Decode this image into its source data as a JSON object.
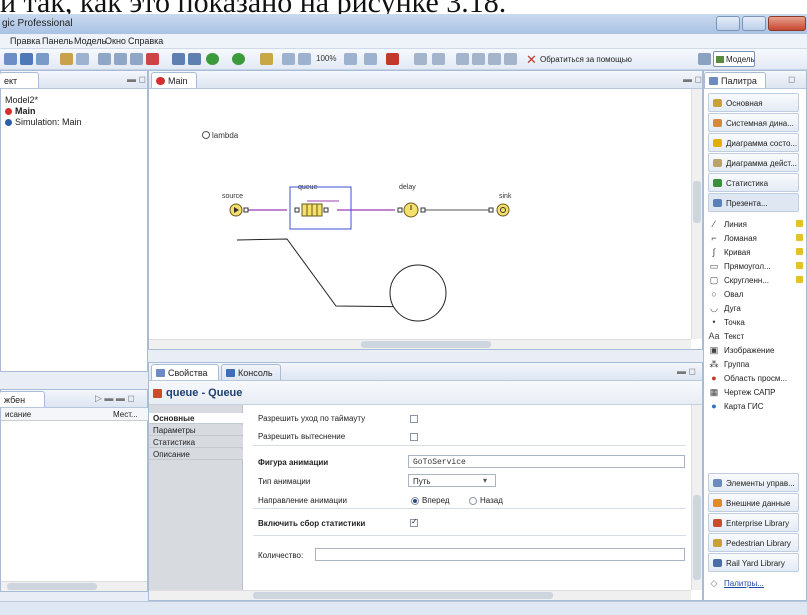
{
  "doc_heading": "и так, как это показано на рисунке 3.18.",
  "window": {
    "title": "gic Professional"
  },
  "menu": [
    "Правка",
    "Панель",
    "Модель",
    "Окно",
    "Справка"
  ],
  "toolbar": {
    "zoom": "100%",
    "help_link": "Обратиться за помощью",
    "model_button": "Модель"
  },
  "project": {
    "tab": "ект",
    "items": [
      "Model2*",
      "Main",
      "Simulation: Main"
    ]
  },
  "editor": {
    "tab": "Main",
    "lambda_label": "lambda",
    "blocks": {
      "source": "source",
      "queue": "queue",
      "delay": "delay",
      "sink": "sink"
    }
  },
  "palette": {
    "tab": "Палитра",
    "categories": [
      "Основная",
      "Системная дина...",
      "Диаграмма состо...",
      "Диаграмма дейст...",
      "Статистика",
      "Презента..."
    ],
    "items": [
      "Линия",
      "Ломаная",
      "Кривая",
      "Прямоугол...",
      "Скругленн...",
      "Овал",
      "Дуга",
      "Точка",
      "Текст",
      "Изображение",
      "Группа",
      "Область просм...",
      "Чертеж САПР",
      "Карта ГИС"
    ],
    "libraries": [
      "Элементы управ...",
      "Внешние данные",
      "Enterprise Library",
      "Pedestrian Library",
      "Rail Yard Library",
      "Палитры..."
    ]
  },
  "bottom_left": {
    "tab": "жбен",
    "columns": [
      "исание",
      "Мест..."
    ]
  },
  "properties": {
    "tab": "Свойства",
    "console_tab": "Консоль",
    "heading": "queue - Queue",
    "side_tabs": [
      "Основные",
      "Параметры",
      "Статистика",
      "Описание"
    ],
    "timeout_label": "Разрешить уход по таймауту",
    "preempt_label": "Разрешить вытеснение",
    "anim_shape_label": "Фигура анимации",
    "anim_shape_value": "GoToService",
    "anim_type_label": "Тип анимации",
    "anim_type_value": "Путь",
    "anim_dir_label": "Направление анимации",
    "anim_dir_forward": "Вперед",
    "anim_dir_back": "Назад",
    "stats_label": "Включить сбор статистики",
    "count_label": "Количество:"
  }
}
